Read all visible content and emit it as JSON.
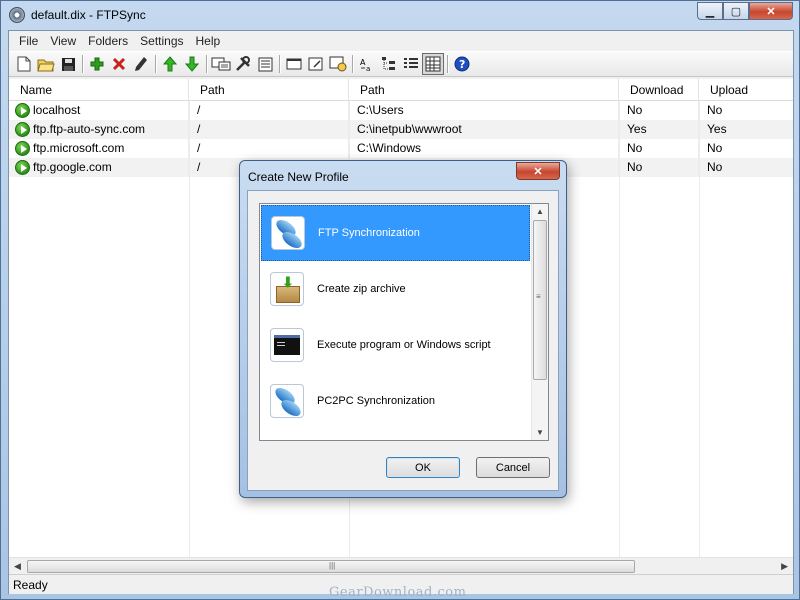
{
  "window": {
    "title": "default.dix - FTPSync",
    "controls": {
      "minimize": "▁",
      "maximize": "▢",
      "close": "✕"
    }
  },
  "menu": [
    "File",
    "View",
    "Folders",
    "Settings",
    "Help"
  ],
  "toolbar_icons": [
    "new-file-icon",
    "open-folder-icon",
    "save-icon",
    "add-icon",
    "delete-icon",
    "edit-icon",
    "move-up-icon",
    "move-down-icon",
    "computer-icon",
    "tools-icon",
    "list-icon",
    "window-icon",
    "window-edit-icon",
    "window-settings-icon",
    "sort-icon",
    "tree-icon",
    "details-icon",
    "grid-view-icon",
    "help-icon"
  ],
  "grid": {
    "headers": [
      "Name",
      "Path",
      "Path",
      "Download",
      "Upload"
    ],
    "rows": [
      {
        "name": "localhost",
        "path1": "/",
        "path2": "C:\\Users",
        "download": "No",
        "upload": "No"
      },
      {
        "name": "ftp.ftp-auto-sync.com",
        "path1": "/",
        "path2": "C:\\inetpub\\wwwroot",
        "download": "Yes",
        "upload": "Yes"
      },
      {
        "name": "ftp.microsoft.com",
        "path1": "/",
        "path2": "C:\\Windows",
        "download": "No",
        "upload": "No"
      },
      {
        "name": "ftp.google.com",
        "path1": "/",
        "path2": "",
        "download": "No",
        "upload": "No"
      }
    ]
  },
  "status": {
    "text": "Ready"
  },
  "watermark": "GearDownload.com",
  "dialog": {
    "title": "Create New Profile",
    "items": [
      {
        "label": "FTP Synchronization",
        "icon": "ftp-sync-icon",
        "selected": true
      },
      {
        "label": "Create zip archive",
        "icon": "zip-archive-icon",
        "selected": false
      },
      {
        "label": "Execute program or Windows script",
        "icon": "console-icon",
        "selected": false
      },
      {
        "label": "PC2PC Synchronization",
        "icon": "pc2pc-sync-icon",
        "selected": false
      }
    ],
    "ok_label": "OK",
    "cancel_label": "Cancel"
  },
  "colors": {
    "selection": "#3399ff",
    "title_bar": "#c4d9ef",
    "close_button": "#c7462f"
  }
}
